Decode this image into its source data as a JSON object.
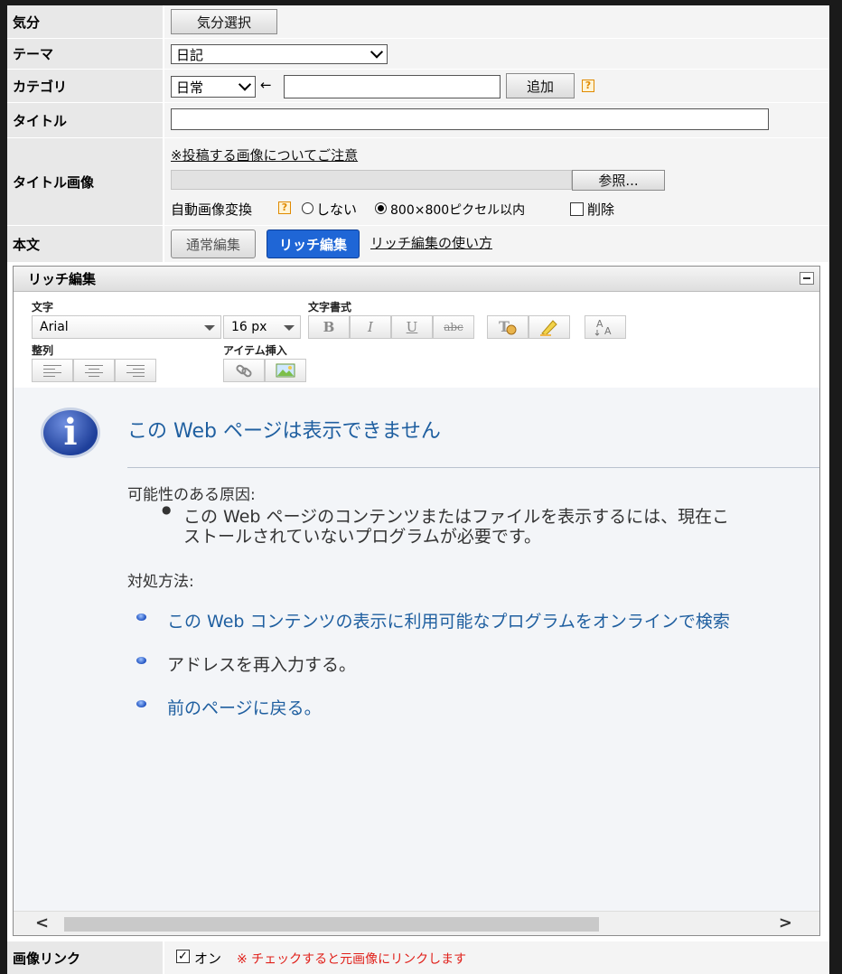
{
  "rows": {
    "mood": {
      "label": "気分",
      "button": "気分選択"
    },
    "theme": {
      "label": "テーマ",
      "selected": "日記"
    },
    "category": {
      "label": "カテゴリ",
      "selected": "日常",
      "arrow": "←",
      "add_button": "追加",
      "help": "?"
    },
    "title": {
      "label": "タイトル",
      "value": ""
    },
    "title_image": {
      "label": "タイトル画像",
      "notice_link": "※投稿する画像についてご注意",
      "browse_button": "参照...",
      "auto_convert_label": "自動画像変換",
      "help": "?",
      "option_off": "しない",
      "option_on": "800×800ピクセル以内",
      "delete_label": "削除"
    },
    "body": {
      "label": "本文",
      "normal_button": "通常編集",
      "rich_button": "リッチ編集",
      "howto_link": "リッチ編集の使い方"
    },
    "image_link": {
      "label": "画像リンク",
      "checkbox_label": "オン",
      "note": "※ チェックすると元画像にリンクします"
    }
  },
  "rich_editor": {
    "title": "リッチ編集",
    "groups": {
      "font": "文字",
      "format": "文字書式",
      "align": "整列",
      "insert": "アイテム挿入"
    },
    "font_family": "Arial",
    "font_size": "16 px",
    "format_buttons": {
      "bold": "B",
      "italic": "I",
      "underline": "U",
      "strike": "abc"
    },
    "color_icons": [
      "text-color-icon",
      "highlight-icon",
      "font-size-icon"
    ]
  },
  "error_page": {
    "title": "この Web ページは表示できません",
    "cause_heading": "可能性のある原因:",
    "cause_line1": "この Web ページのコンテンツまたはファイルを表示するには、現在こ",
    "cause_line2": "ストールされていないプログラムが必要です。",
    "remedy_heading": "対処方法:",
    "remedies": [
      "この Web コンテンツの表示に利用可能なプログラムをオンラインで検索",
      "アドレスを再入力する。",
      "前のページに戻る。"
    ]
  },
  "colors": {
    "accent_blue": "#1f66d6",
    "link_blue": "#1f5fa0",
    "note_red": "#e0201a",
    "help_orange": "#e08a00"
  }
}
